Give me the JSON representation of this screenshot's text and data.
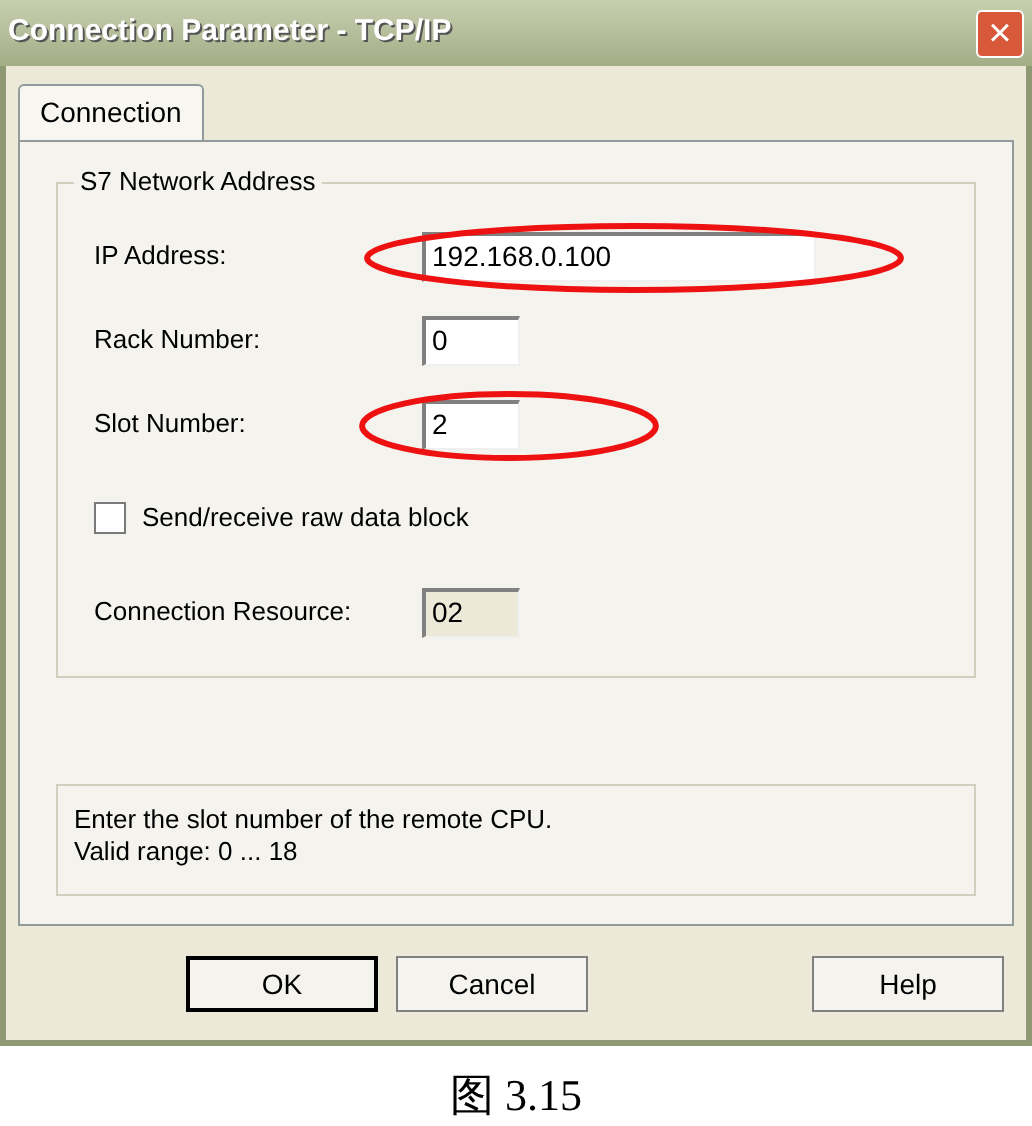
{
  "window": {
    "title": "Connection Parameter - TCP/IP",
    "close": "×"
  },
  "tabs": [
    {
      "label": "Connection",
      "selected": true
    }
  ],
  "group": {
    "title": "S7 Network Address"
  },
  "fields": [
    {
      "kind": "text",
      "label": "IP Address:",
      "value": "192.168.0.100",
      "wide": true,
      "disabled": false,
      "highlighted": true
    },
    {
      "kind": "text",
      "label": "Rack Number:",
      "value": "0",
      "wide": false,
      "disabled": false,
      "highlighted": false
    },
    {
      "kind": "text",
      "label": "Slot Number:",
      "value": "2",
      "wide": false,
      "disabled": false,
      "highlighted": true
    },
    {
      "kind": "checkbox",
      "label": "Send/receive raw data block",
      "checked": false
    },
    {
      "kind": "text",
      "label": "Connection Resource:",
      "value": "02",
      "wide": false,
      "disabled": true,
      "highlighted": false
    }
  ],
  "info": {
    "lines": [
      "Enter the slot number of the remote CPU.",
      "Valid range: 0 ... 18"
    ]
  },
  "buttons": [
    {
      "label": "OK",
      "default": true
    },
    {
      "label": "Cancel",
      "default": false
    },
    {
      "label": "Help",
      "default": false
    }
  ],
  "caption": "图 3.15"
}
